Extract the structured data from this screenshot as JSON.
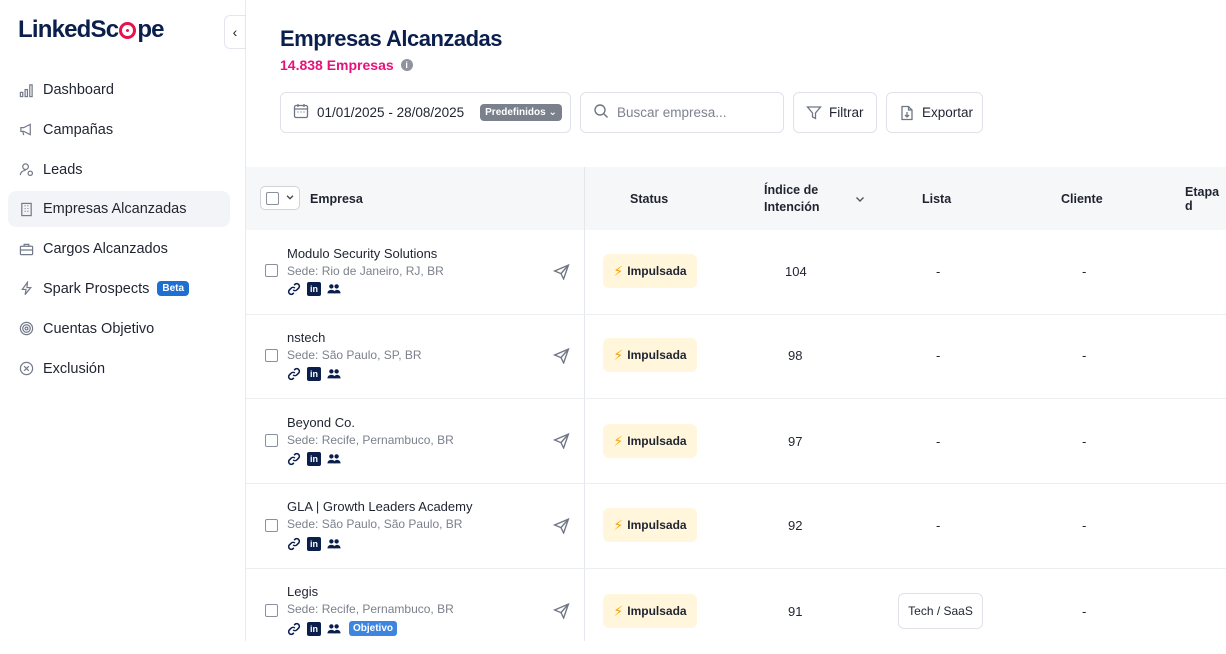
{
  "app": {
    "logo_text_pre": "LinkedSc",
    "logo_text_post": "pe"
  },
  "sidebar": {
    "items": [
      {
        "label": "Dashboard",
        "icon": "bar-chart-icon"
      },
      {
        "label": "Campañas",
        "icon": "megaphone-icon"
      },
      {
        "label": "Leads",
        "icon": "user-icon"
      },
      {
        "label": "Empresas Alcanzadas",
        "icon": "building-icon",
        "active": true
      },
      {
        "label": "Cargos Alcanzados",
        "icon": "briefcase-icon"
      },
      {
        "label": "Spark Prospects",
        "icon": "lightning-icon",
        "badge": "Beta"
      },
      {
        "label": "Cuentas Objetivo",
        "icon": "target-icon"
      },
      {
        "label": "Exclusión",
        "icon": "x-circle-icon"
      }
    ]
  },
  "header": {
    "title": "Empresas Alcanzadas",
    "count": "14.838 Empresas",
    "info_glyph": "i"
  },
  "toolbar": {
    "date_range": "01/01/2025 - 28/08/2025",
    "presets_label": "Predefinidos",
    "search_placeholder": "Buscar empresa...",
    "filter_label": "Filtrar",
    "export_label": "Exportar"
  },
  "table": {
    "columns": {
      "empresa": "Empresa",
      "status": "Status",
      "indice_line1": "Índice de",
      "indice_line2": "Intención",
      "lista": "Lista",
      "cliente": "Cliente",
      "etapa": "Etapa d"
    },
    "rows": [
      {
        "name": "Modulo Security Solutions",
        "sede": "Sede: Rio de Janeiro, RJ, BR",
        "status": "Impulsada",
        "indice": "104",
        "lista": "-",
        "cliente": "-"
      },
      {
        "name": "nstech",
        "sede": "Sede: São Paulo, SP, BR",
        "status": "Impulsada",
        "indice": "98",
        "lista": "-",
        "cliente": "-"
      },
      {
        "name": "Beyond Co.",
        "sede": "Sede: Recife, Pernambuco, BR",
        "status": "Impulsada",
        "indice": "97",
        "lista": "-",
        "cliente": "-"
      },
      {
        "name": "GLA | Growth Leaders Academy",
        "sede": "Sede: São Paulo, São Paulo, BR",
        "status": "Impulsada",
        "indice": "92",
        "lista": "-",
        "cliente": "-"
      },
      {
        "name": "Legis",
        "sede": "Sede: Recife, Pernambuco, BR",
        "status": "Impulsada",
        "indice": "91",
        "lista": "Tech / SaaS",
        "cliente": "-",
        "badge": "Objetivo"
      }
    ]
  },
  "colors": {
    "brand_navy": "#0b1f4d",
    "brand_pink": "#e6127c",
    "status_bg": "#fff6dc",
    "beta_blue": "#1f6fd1"
  }
}
